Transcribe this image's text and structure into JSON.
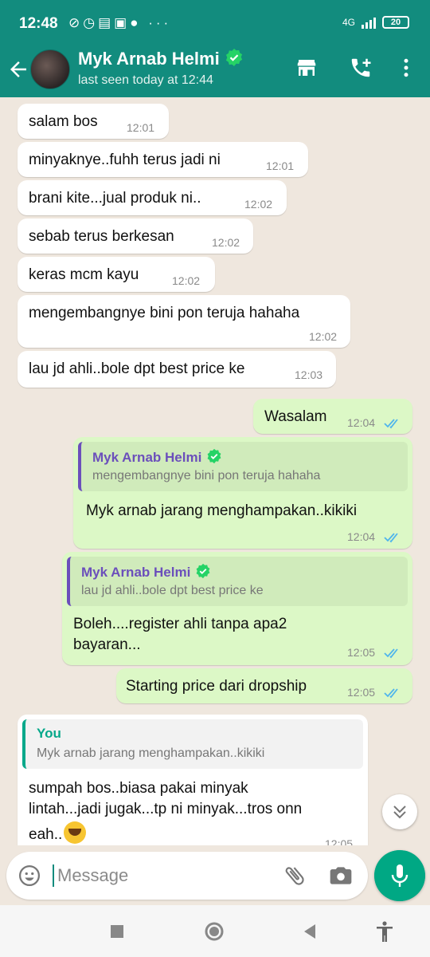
{
  "status_bar": {
    "time": "12:48",
    "network": "4G",
    "battery": "20"
  },
  "header": {
    "contact_name": "Myk Arnab Helmi",
    "last_seen": "last seen today at 12:44",
    "colors": {
      "header_bg": "#128c7e",
      "verified": "#25d366"
    }
  },
  "messages": [
    {
      "direction": "in",
      "text": "salam bos",
      "time": "12:01"
    },
    {
      "direction": "in",
      "text": "minyaknye..fuhh terus jadi ni",
      "time": "12:01"
    },
    {
      "direction": "in",
      "text": "brani kite...jual produk ni..",
      "time": "12:02"
    },
    {
      "direction": "in",
      "text": "sebab terus berkesan",
      "time": "12:02"
    },
    {
      "direction": "in",
      "text": "keras mcm kayu",
      "time": "12:02"
    },
    {
      "direction": "in",
      "text": "mengembangnye bini pon teruja hahaha",
      "time": "12:02"
    },
    {
      "direction": "in",
      "text": "lau jd ahli..bole dpt best price ke",
      "time": "12:03"
    },
    {
      "direction": "out",
      "text": "Wasalam",
      "time": "12:04"
    },
    {
      "direction": "out",
      "quote_name": "Myk Arnab Helmi",
      "quote_text": "mengembangnye bini pon teruja hahaha",
      "text": "Myk arnab jarang menghampakan..kikiki",
      "time": "12:04"
    },
    {
      "direction": "out",
      "quote_name": "Myk Arnab Helmi",
      "quote_text": "lau jd ahli..bole dpt best price ke",
      "line1": "Boleh....register ahli tanpa apa2",
      "line2": "bayaran...",
      "time": "12:05"
    },
    {
      "direction": "out",
      "text": "Starting price dari dropship",
      "time": "12:05"
    },
    {
      "direction": "in",
      "quote_name": "You",
      "quote_text": "Myk arnab jarang menghampakan..kikiki",
      "line1": "sumpah bos..biasa pakai minyak",
      "line2": "lintah...jadi jugak...tp ni minyak...tros onn",
      "line3": "eah..",
      "time": "12:05"
    }
  ],
  "composer": {
    "placeholder": "Message"
  },
  "icons": {
    "back": "arrow-left-icon",
    "shop": "store-icon",
    "call": "add-call-icon",
    "menu": "more-vert-icon",
    "emoji": "emoji-icon",
    "attach": "paperclip-icon",
    "camera": "camera-icon",
    "mic": "microphone-icon",
    "scroll": "chevrons-down-icon",
    "read": "double-check-icon"
  },
  "colors": {
    "chat_bg": "#efe7de",
    "incoming": "#ffffff",
    "outgoing": "#dcf8c6",
    "tick_read": "#4fb5ec",
    "mic_bg": "#00a884"
  }
}
